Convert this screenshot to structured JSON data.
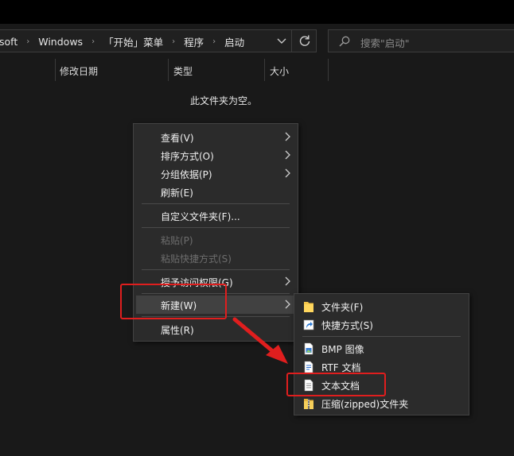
{
  "address_bar": {
    "crumbs": [
      "soft",
      "Windows",
      "「开始」菜单",
      "程序",
      "启动"
    ],
    "separator": "›",
    "dropdown_glyph": "⌄",
    "refresh_glyph": "↻"
  },
  "search": {
    "placeholder": "搜索\"启动\""
  },
  "columns": [
    "修改日期",
    "类型",
    "大小"
  ],
  "empty_message": "此文件夹为空。",
  "context_menu": {
    "items": [
      {
        "label": "查看(V)",
        "submenu": true
      },
      {
        "label": "排序方式(O)",
        "submenu": true
      },
      {
        "label": "分组依据(P)",
        "submenu": true
      },
      {
        "label": "刷新(E)"
      },
      {
        "label": "自定义文件夹(F)..."
      },
      {
        "label": "粘贴(P)",
        "disabled": true
      },
      {
        "label": "粘贴快捷方式(S)",
        "disabled": true
      },
      {
        "label": "授予访问权限(G)",
        "submenu": true
      },
      {
        "label": "新建(W)",
        "submenu": true,
        "highlighted": true
      },
      {
        "label": "属性(R)"
      }
    ]
  },
  "new_submenu": {
    "items": [
      {
        "label": "文件夹(F)",
        "icon": "folder-icon"
      },
      {
        "label": "快捷方式(S)",
        "icon": "shortcut-icon"
      },
      {
        "label": "BMP 图像",
        "icon": "bmp-image-icon"
      },
      {
        "label": "RTF 文档",
        "icon": "rtf-document-icon"
      },
      {
        "label": "文本文档",
        "icon": "text-document-icon"
      },
      {
        "label": "压缩(zipped)文件夹",
        "icon": "zip-folder-icon"
      }
    ]
  },
  "colors": {
    "background": "#191919",
    "menu_background": "#2b2b2b",
    "highlight": "#414141",
    "annotation_red": "#e01e1e"
  }
}
